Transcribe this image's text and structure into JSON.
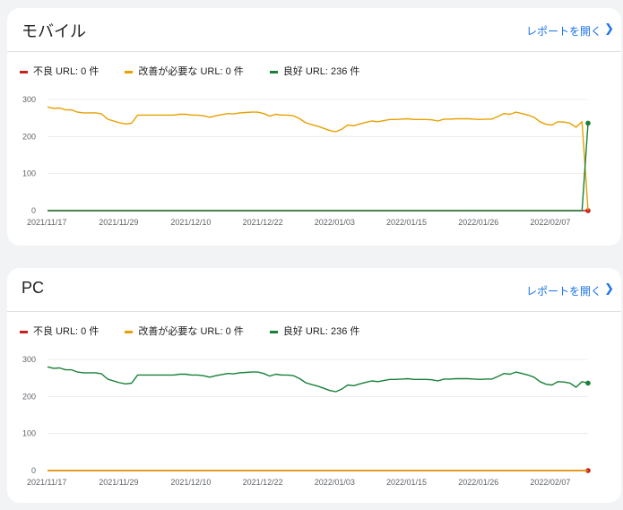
{
  "colors": {
    "poor": "#c5221f",
    "needs_improvement": "#e8a000",
    "good": "#188038",
    "link": "#1a73e8"
  },
  "report_link_label": "レポートを開く",
  "chevron_icon": "chevron-right-icon",
  "cards": [
    {
      "title": "モバイル",
      "legend": {
        "poor": "不良 URL: 0 件",
        "needs_improvement": "改善が必要な URL: 0 件",
        "good": "良好 URL: 236 件"
      }
    },
    {
      "title": "PC",
      "legend": {
        "poor": "不良 URL: 0 件",
        "needs_improvement": "改善が必要な URL: 0 件",
        "good": "良好 URL: 236 件"
      }
    }
  ],
  "chart_data": [
    {
      "type": "line",
      "x_tick_labels": [
        "2021/11/17",
        "2021/11/29",
        "2021/12/10",
        "2021/12/22",
        "2022/01/03",
        "2022/01/15",
        "2022/01/26",
        "2022/02/07"
      ],
      "y_ticks": [
        0,
        100,
        200,
        300
      ],
      "ylim": [
        0,
        300
      ],
      "grid": true,
      "legend_position": "top-left",
      "series": [
        {
          "name": "不良 URL",
          "color": "#c5221f",
          "marker_last": true,
          "values": [
            0,
            0,
            0,
            0,
            0,
            0,
            0,
            0,
            0,
            0,
            0,
            0,
            0,
            0,
            0,
            0,
            0,
            0,
            0,
            0,
            0,
            0,
            0,
            0,
            0,
            0,
            0,
            0,
            0,
            0,
            0,
            0,
            0,
            0,
            0,
            0,
            0,
            0,
            0,
            0,
            0,
            0,
            0,
            0,
            0,
            0,
            0,
            0,
            0,
            0,
            0,
            0,
            0,
            0,
            0,
            0,
            0,
            0,
            0,
            0,
            0,
            0,
            0,
            0,
            0,
            0,
            0,
            0,
            0,
            0,
            0,
            0,
            0,
            0,
            0,
            0,
            0,
            0,
            0,
            0,
            0,
            0,
            0,
            0,
            0,
            0,
            0,
            0,
            0
          ]
        },
        {
          "name": "改善が必要な URL",
          "color": "#e8a000",
          "marker_last": false,
          "values": [
            280,
            276,
            277,
            272,
            272,
            266,
            264,
            264,
            264,
            261,
            247,
            242,
            237,
            234,
            236,
            258,
            258,
            258,
            258,
            258,
            258,
            258,
            260,
            260,
            258,
            258,
            256,
            252,
            256,
            259,
            262,
            261,
            264,
            265,
            266,
            266,
            262,
            255,
            260,
            258,
            258,
            256,
            248,
            237,
            232,
            228,
            222,
            216,
            213,
            220,
            231,
            229,
            234,
            238,
            242,
            240,
            243,
            246,
            246,
            247,
            248,
            246,
            246,
            246,
            245,
            242,
            247,
            247,
            248,
            248,
            248,
            247,
            246,
            247,
            247,
            254,
            262,
            260,
            266,
            262,
            258,
            252,
            240,
            233,
            231,
            240,
            239,
            236,
            225,
            240,
            0
          ]
        },
        {
          "name": "良好 URL",
          "color": "#188038",
          "marker_last": true,
          "values": [
            0,
            0,
            0,
            0,
            0,
            0,
            0,
            0,
            0,
            0,
            0,
            0,
            0,
            0,
            0,
            0,
            0,
            0,
            0,
            0,
            0,
            0,
            0,
            0,
            0,
            0,
            0,
            0,
            0,
            0,
            0,
            0,
            0,
            0,
            0,
            0,
            0,
            0,
            0,
            0,
            0,
            0,
            0,
            0,
            0,
            0,
            0,
            0,
            0,
            0,
            0,
            0,
            0,
            0,
            0,
            0,
            0,
            0,
            0,
            0,
            0,
            0,
            0,
            0,
            0,
            0,
            0,
            0,
            0,
            0,
            0,
            0,
            0,
            0,
            0,
            0,
            0,
            0,
            0,
            0,
            0,
            0,
            0,
            0,
            0,
            0,
            0,
            0,
            0,
            0,
            236
          ]
        }
      ]
    },
    {
      "type": "line",
      "x_tick_labels": [
        "2021/11/17",
        "2021/11/29",
        "2021/12/10",
        "2021/12/22",
        "2022/01/03",
        "2022/01/15",
        "2022/01/26",
        "2022/02/07"
      ],
      "y_ticks": [
        0,
        100,
        200,
        300
      ],
      "ylim": [
        0,
        300
      ],
      "grid": true,
      "legend_position": "top-left",
      "series": [
        {
          "name": "不良 URL",
          "color": "#c5221f",
          "marker_last": true,
          "values": [
            0,
            0,
            0,
            0,
            0,
            0,
            0,
            0,
            0,
            0,
            0,
            0,
            0,
            0,
            0,
            0,
            0,
            0,
            0,
            0,
            0,
            0,
            0,
            0,
            0,
            0,
            0,
            0,
            0,
            0,
            0,
            0,
            0,
            0,
            0,
            0,
            0,
            0,
            0,
            0,
            0,
            0,
            0,
            0,
            0,
            0,
            0,
            0,
            0,
            0,
            0,
            0,
            0,
            0,
            0,
            0,
            0,
            0,
            0,
            0,
            0,
            0,
            0,
            0,
            0,
            0,
            0,
            0,
            0,
            0,
            0,
            0,
            0,
            0,
            0,
            0,
            0,
            0,
            0,
            0,
            0,
            0,
            0,
            0,
            0,
            0,
            0,
            0,
            0,
            0,
            0
          ]
        },
        {
          "name": "改善が必要な URL",
          "color": "#e8a000",
          "marker_last": false,
          "values": [
            0,
            0,
            0,
            0,
            0,
            0,
            0,
            0,
            0,
            0,
            0,
            0,
            0,
            0,
            0,
            0,
            0,
            0,
            0,
            0,
            0,
            0,
            0,
            0,
            0,
            0,
            0,
            0,
            0,
            0,
            0,
            0,
            0,
            0,
            0,
            0,
            0,
            0,
            0,
            0,
            0,
            0,
            0,
            0,
            0,
            0,
            0,
            0,
            0,
            0,
            0,
            0,
            0,
            0,
            0,
            0,
            0,
            0,
            0,
            0,
            0,
            0,
            0,
            0,
            0,
            0,
            0,
            0,
            0,
            0,
            0,
            0,
            0,
            0,
            0,
            0,
            0,
            0,
            0,
            0,
            0,
            0,
            0,
            0,
            0,
            0,
            0,
            0,
            0,
            0,
            0
          ]
        },
        {
          "name": "良好 URL",
          "color": "#188038",
          "marker_last": true,
          "values": [
            280,
            276,
            277,
            272,
            272,
            266,
            264,
            264,
            264,
            261,
            247,
            242,
            237,
            234,
            236,
            258,
            258,
            258,
            258,
            258,
            258,
            258,
            260,
            260,
            258,
            258,
            256,
            252,
            256,
            259,
            262,
            261,
            264,
            265,
            266,
            266,
            262,
            255,
            260,
            258,
            258,
            256,
            248,
            237,
            232,
            228,
            222,
            216,
            213,
            220,
            231,
            229,
            234,
            238,
            242,
            240,
            243,
            246,
            246,
            247,
            248,
            246,
            246,
            246,
            245,
            242,
            247,
            247,
            248,
            248,
            248,
            247,
            246,
            247,
            247,
            254,
            262,
            260,
            266,
            262,
            258,
            252,
            240,
            233,
            231,
            240,
            239,
            236,
            225,
            240,
            236
          ]
        }
      ]
    }
  ]
}
